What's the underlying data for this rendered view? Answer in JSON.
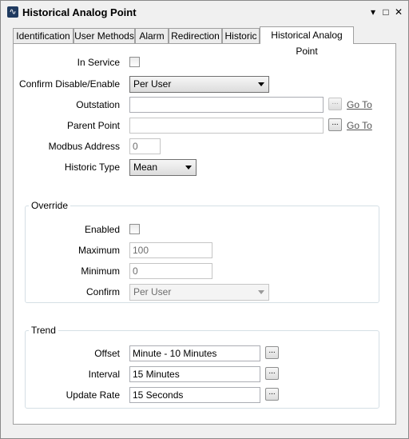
{
  "window": {
    "title": "Historical Analog Point",
    "controls": {
      "menu": "▾",
      "maximize": "□",
      "close": "✕"
    }
  },
  "tabs": [
    {
      "label": "Identification"
    },
    {
      "label": "User Methods"
    },
    {
      "label": "Alarm"
    },
    {
      "label": "Redirection"
    },
    {
      "label": "Historic"
    },
    {
      "label": "Historical Analog Point",
      "active": true
    }
  ],
  "main": {
    "in_service": {
      "label": "In Service",
      "checked": false
    },
    "confirm_disable": {
      "label": "Confirm Disable/Enable",
      "value": "Per User"
    },
    "outstation": {
      "label": "Outstation",
      "value": "",
      "button": "...",
      "link": "Go To"
    },
    "parent_point": {
      "label": "Parent Point",
      "value": "",
      "button": "...",
      "link": "Go To"
    },
    "modbus_address": {
      "label": "Modbus Address",
      "value": "0"
    },
    "historic_type": {
      "label": "Historic Type",
      "value": "Mean"
    }
  },
  "override": {
    "title": "Override",
    "enabled": {
      "label": "Enabled",
      "checked": false
    },
    "maximum": {
      "label": "Maximum",
      "value": "100"
    },
    "minimum": {
      "label": "Minimum",
      "value": "0"
    },
    "confirm": {
      "label": "Confirm",
      "value": "Per User"
    }
  },
  "trend": {
    "title": "Trend",
    "offset": {
      "label": "Offset",
      "value": "Minute - 10 Minutes",
      "button": "..."
    },
    "interval": {
      "label": "Interval",
      "value": "15 Minutes",
      "button": "..."
    },
    "update_rate": {
      "label": "Update Rate",
      "value": "15 Seconds",
      "button": "..."
    }
  }
}
